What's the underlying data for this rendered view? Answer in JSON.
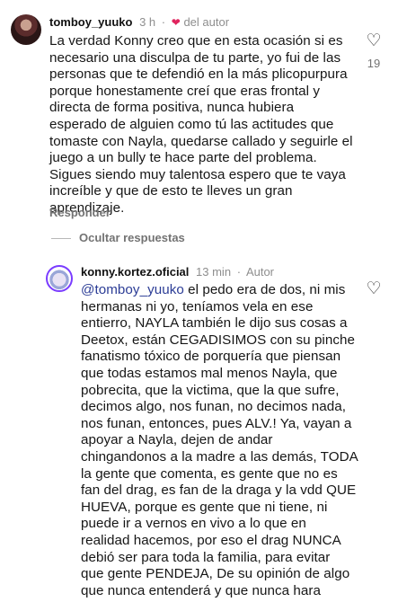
{
  "comments": [
    {
      "username": "tomboy_yuuko",
      "time": "3 h",
      "separator": "·",
      "author_badge": "del autor",
      "body_lines": [
        "La verdad Konny creo que en esta ocasión si es",
        "necesario una disculpa de tu parte, yo fui de las",
        "personas que te defendió en la más plicopurpura",
        "porque honestamente creí que eras frontal y",
        "directa de forma positiva, nunca hubiera",
        "esperado de alguien como tú las actitudes que",
        "tomaste con Nayla, quedarse callado y seguirle el",
        "juego a un bully te hace parte del problema.",
        "Sigues siendo muy talentosa espero que te vaya",
        "increíble y que de esto te lleves un gran",
        "aprendizaje."
      ],
      "reply_label": "Responder",
      "like_count": "19"
    },
    {
      "username": "konny.kortez.oficial",
      "time": "13 min",
      "separator": "·",
      "author_badge": "Autor",
      "mention": "@tomboy_yuuko",
      "first_line_rest": " el pedo era de dos, ni mis",
      "body_lines": [
        "hermanas ni yo, teníamos vela en ese",
        "entierro, NAYLA también le dijo sus cosas a",
        "Deetox, están CEGADISIMOS con su pinche",
        "fanatismo tóxico de porquería que piensan",
        "que todas estamos mal menos Nayla, que",
        "pobrecita, que la victima, que la que sufre,",
        "decimos algo, nos funan, no decimos nada,",
        "nos funan, entonces, pues ALV.! Ya, vayan a",
        "apoyar a Nayla, dejen de andar",
        "chingandonos a la madre a las demás, TODA",
        "la gente que comenta, es gente que no es",
        "fan del drag, es fan de la draga y la vdd QUE",
        "HUEVA, porque es gente que ni tiene, ni",
        "puede ir a vernos en vivo a lo que en",
        "realidad hacemos, por eso el drag NUNCA",
        "debió ser para toda la familia, para evitar",
        "que gente PENDEJA, De su opinión de algo",
        "que nunca entenderá y que nunca hara"
      ]
    }
  ],
  "hide_replies_label": "Ocultar respuestas",
  "icons": {
    "like": "heart-outline-icon",
    "author_heart": "heart-filled-icon"
  },
  "colors": {
    "mention": "#2c3d96",
    "author_heart": "#e0245e",
    "secondary_text": "#737373"
  }
}
